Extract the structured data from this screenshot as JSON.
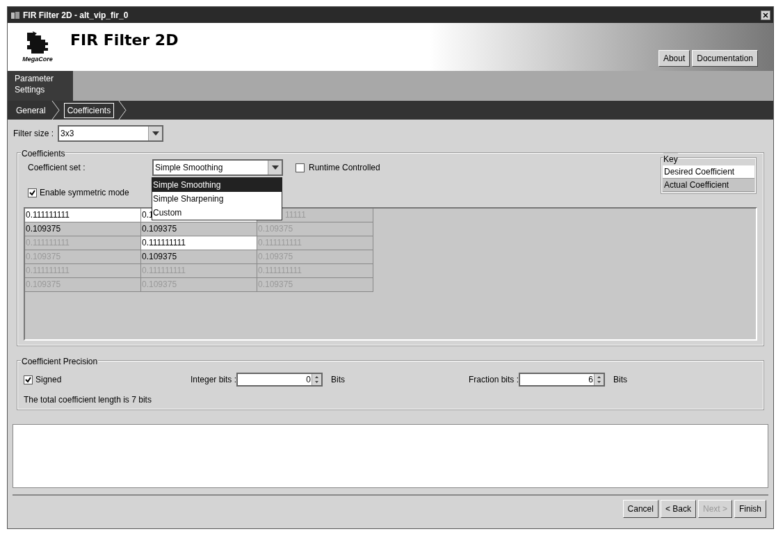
{
  "window": {
    "title": "FIR Filter 2D - alt_vip_fir_0"
  },
  "header": {
    "logo_caption": "MegaCore",
    "title": "FIR Filter 2D",
    "buttons": [
      "About",
      "Documentation"
    ]
  },
  "side_tab": {
    "label": "Parameter Settings"
  },
  "breadcrumbs": [
    {
      "label": "General",
      "selected": false
    },
    {
      "label": "Coefficients",
      "selected": true
    }
  ],
  "filter_size": {
    "label": "Filter size :",
    "value": "3x3"
  },
  "coefficients": {
    "legend": "Coefficients",
    "set_label": "Coefficient set :",
    "set_value": "Simple Smoothing",
    "set_options": [
      {
        "label": "Simple Smoothing",
        "selected": true
      },
      {
        "label": "Simple Sharpening",
        "selected": false
      },
      {
        "label": "Custom",
        "selected": false
      }
    ],
    "runtime_controlled": {
      "label": "Runtime Controlled",
      "checked": false
    },
    "symmetric": {
      "label": "Enable symmetric mode",
      "checked": true
    },
    "key": {
      "legend": "Key",
      "items": [
        {
          "label": "Desired Coefficient",
          "kind": "desired"
        },
        {
          "label": "Actual Coefficient",
          "kind": "actual"
        }
      ]
    },
    "grid": [
      [
        {
          "text": "0.111111111",
          "kind": "desired"
        },
        {
          "text": "0.1",
          "kind": "desired"
        },
        {
          "text": "11111",
          "kind": "mirrored",
          "covered": true
        }
      ],
      [
        {
          "text": "0.109375",
          "kind": "actual"
        },
        {
          "text": "0.109375",
          "kind": "actual"
        },
        {
          "text": "0.109375",
          "kind": "mirrored"
        }
      ],
      [
        {
          "text": "0.111111111",
          "kind": "mirrored"
        },
        {
          "text": "0.111111111",
          "kind": "desired"
        },
        {
          "text": "0.111111111",
          "kind": "mirrored"
        }
      ],
      [
        {
          "text": "0.109375",
          "kind": "mirrored"
        },
        {
          "text": "0.109375",
          "kind": "actual"
        },
        {
          "text": "0.109375",
          "kind": "mirrored"
        }
      ],
      [
        {
          "text": "0.111111111",
          "kind": "mirrored"
        },
        {
          "text": "0.111111111",
          "kind": "mirrored"
        },
        {
          "text": "0.111111111",
          "kind": "mirrored"
        }
      ],
      [
        {
          "text": "0.109375",
          "kind": "mirrored"
        },
        {
          "text": "0.109375",
          "kind": "mirrored"
        },
        {
          "text": "0.109375",
          "kind": "mirrored"
        }
      ]
    ]
  },
  "precision": {
    "legend": "Coefficient Precision",
    "signed": {
      "label": "Signed",
      "checked": true
    },
    "integer_bits": {
      "label": "Integer bits :",
      "value": "0",
      "unit": "Bits"
    },
    "fraction_bits": {
      "label": "Fraction bits :",
      "value": "6",
      "unit": "Bits"
    },
    "summary": "The total coefficient length is 7 bits"
  },
  "footer_buttons": [
    {
      "label": "Cancel",
      "disabled": false
    },
    {
      "label": "< Back",
      "disabled": false
    },
    {
      "label": "Next >",
      "disabled": true
    },
    {
      "label": "Finish",
      "disabled": false
    }
  ]
}
